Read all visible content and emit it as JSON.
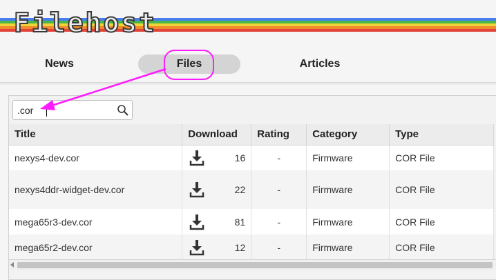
{
  "header": {
    "logo_text": "Filehost",
    "stripe_colors": [
      "#4a7ef0",
      "#45b849",
      "#f0d23a",
      "#f08a2a",
      "#e2433a"
    ]
  },
  "nav": {
    "tabs": [
      {
        "label": "News"
      },
      {
        "label": "Files",
        "active": true
      },
      {
        "label": "Articles"
      }
    ]
  },
  "search": {
    "value": ".cor",
    "icon": "search-icon"
  },
  "table": {
    "columns": [
      "Title",
      "Download",
      "Rating",
      "Category",
      "Type"
    ],
    "rows": [
      {
        "title": "nexys4-dev.cor",
        "downloads": "16",
        "rating": "-",
        "category": "Firmware",
        "type": "COR File"
      },
      {
        "title": "nexys4ddr-widget-dev.cor",
        "downloads": "22",
        "rating": "-",
        "category": "Firmware",
        "type": "COR File"
      },
      {
        "title": "mega65r3-dev.cor",
        "downloads": "81",
        "rating": "-",
        "category": "Firmware",
        "type": "COR File"
      },
      {
        "title": "mega65r2-dev.cor",
        "downloads": "12",
        "rating": "-",
        "category": "Firmware",
        "type": "COR File"
      }
    ]
  },
  "annotation": {
    "color": "#ff1aff"
  }
}
